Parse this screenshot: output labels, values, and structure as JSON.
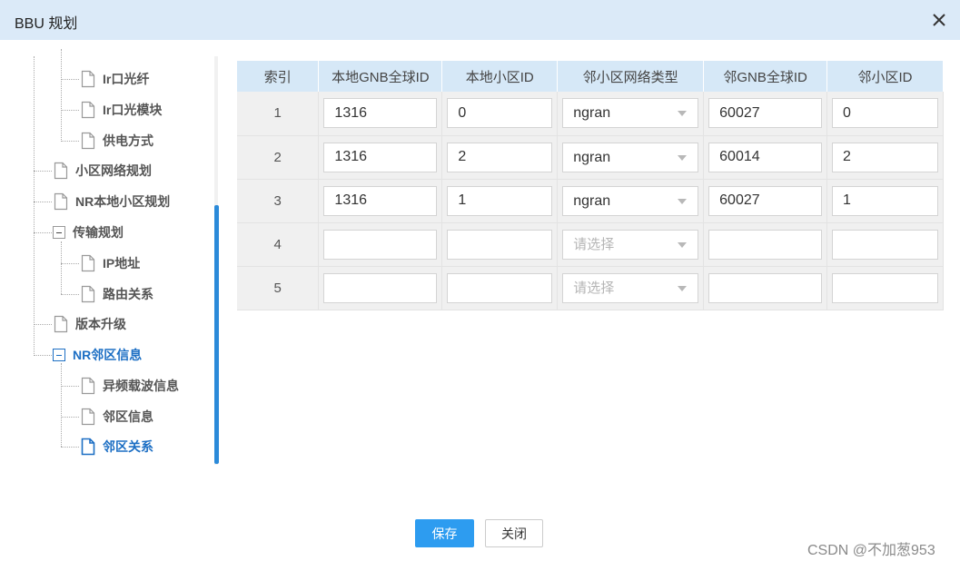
{
  "dialog": {
    "title": "BBU 规划",
    "close_icon": "close-icon"
  },
  "tree": {
    "items": [
      {
        "label": "Ir口光纤"
      },
      {
        "label": "Ir口光模块"
      },
      {
        "label": "供电方式"
      },
      {
        "label": "小区网络规划"
      },
      {
        "label": "NR本地小区规划"
      },
      {
        "label": "传输规划"
      },
      {
        "label": "IP地址"
      },
      {
        "label": "路由关系"
      },
      {
        "label": "版本升级"
      },
      {
        "label": "NR邻区信息"
      },
      {
        "label": "异频载波信息"
      },
      {
        "label": "邻区信息"
      },
      {
        "label": "邻区关系"
      }
    ],
    "selected": "邻区关系",
    "accent_color": "#1d6fc4"
  },
  "table": {
    "headers": [
      "索引",
      "本地GNB全球ID",
      "本地小区ID",
      "邻小区网络类型",
      "邻GNB全球ID",
      "邻小区ID"
    ],
    "select_placeholder": "请选择",
    "rows": [
      {
        "index": "1",
        "local_gnb": "1316",
        "local_cell": "0",
        "net_type": "ngran",
        "nbr_gnb": "60027",
        "nbr_cell": "0"
      },
      {
        "index": "2",
        "local_gnb": "1316",
        "local_cell": "2",
        "net_type": "ngran",
        "nbr_gnb": "60014",
        "nbr_cell": "2"
      },
      {
        "index": "3",
        "local_gnb": "1316",
        "local_cell": "1",
        "net_type": "ngran",
        "nbr_gnb": "60027",
        "nbr_cell": "1"
      },
      {
        "index": "4",
        "local_gnb": "",
        "local_cell": "",
        "net_type": "",
        "nbr_gnb": "",
        "nbr_cell": ""
      },
      {
        "index": "5",
        "local_gnb": "",
        "local_cell": "",
        "net_type": "",
        "nbr_gnb": "",
        "nbr_cell": ""
      }
    ]
  },
  "footer": {
    "save_label": "保存",
    "close_label": "关闭",
    "save_color": "#2d9cf0"
  },
  "watermark": "CSDN @不加葱953"
}
